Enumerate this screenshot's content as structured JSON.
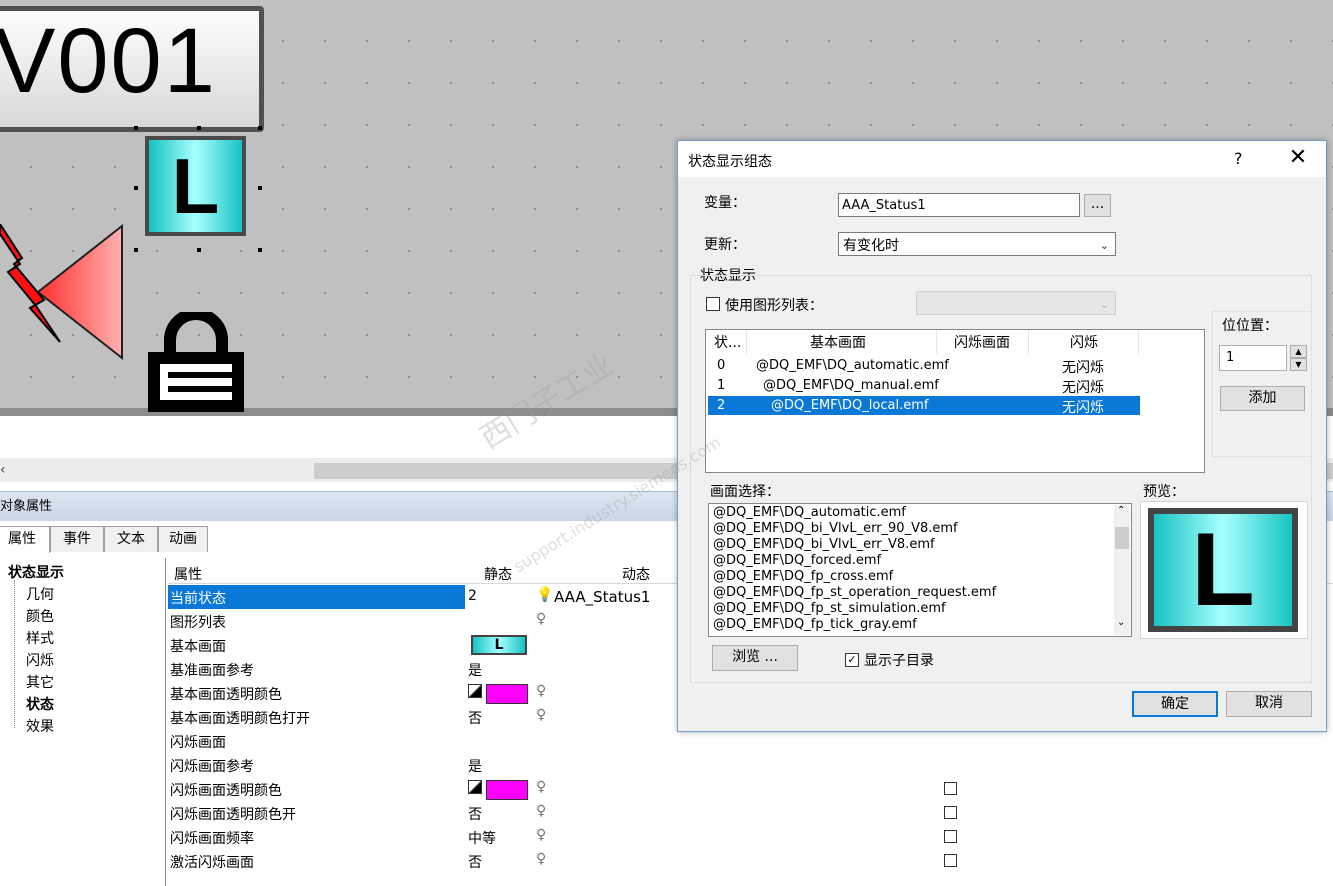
{
  "canvas": {
    "io_text": "V001",
    "l_icon_text": "L"
  },
  "properties_panel": {
    "title": "对象属性",
    "tabs": [
      "属性",
      "事件",
      "文本",
      "动画"
    ],
    "tree": {
      "root": "状态显示",
      "items": [
        "几何",
        "颜色",
        "样式",
        "闪烁",
        "其它",
        "状态",
        "效果"
      ]
    },
    "grid_headers": {
      "property": "属性",
      "static": "静态",
      "dynamic": "动态"
    },
    "rows": [
      {
        "name": "当前状态",
        "static": "2",
        "dynamic": "AAA_Status1"
      },
      {
        "name": "图形列表",
        "static": "",
        "dynamic": ""
      },
      {
        "name": "基本画面",
        "static": "L",
        "dynamic": ""
      },
      {
        "name": "基准画面参考",
        "static": "是",
        "dynamic": ""
      },
      {
        "name": "基本画面透明颜色",
        "static": "",
        "dynamic": ""
      },
      {
        "name": "基本画面透明颜色打开",
        "static": "否",
        "dynamic": ""
      },
      {
        "name": "闪烁画面",
        "static": "",
        "dynamic": ""
      },
      {
        "name": "闪烁画面参考",
        "static": "是",
        "dynamic": ""
      },
      {
        "name": "闪烁画面透明颜色",
        "static": "",
        "dynamic": ""
      },
      {
        "name": "闪烁画面透明颜色开",
        "static": "否",
        "dynamic": ""
      },
      {
        "name": "闪烁画面频率",
        "static": "中等",
        "dynamic": ""
      },
      {
        "name": "激活闪烁画面",
        "static": "否",
        "dynamic": ""
      }
    ]
  },
  "dialog": {
    "title": "状态显示组态",
    "help": "?",
    "close": "✕",
    "variable_label": "变量：",
    "variable_value": "AAA_Status1",
    "browse_var": "...",
    "update_label": "更新：",
    "update_value": "有变化时",
    "group_label": "状态显示",
    "use_graphic_list": "使用图形列表：",
    "bit_position_label": "位位置：",
    "bit_position_value": "1",
    "add_button": "添加",
    "state_headers": [
      "状...",
      "基本画面",
      "闪烁画面",
      "闪烁"
    ],
    "states": [
      {
        "state": "0",
        "basic": "@DQ_EMF\\DQ_automatic.emf",
        "flash": "",
        "blink": "无闪烁"
      },
      {
        "state": "1",
        "basic": "@DQ_EMF\\DQ_manual.emf",
        "flash": "",
        "blink": "无闪烁"
      },
      {
        "state": "2",
        "basic": "@DQ_EMF\\DQ_local.emf",
        "flash": "",
        "blink": "无闪烁"
      }
    ],
    "picture_select_label": "画面选择：",
    "pictures": [
      "@DQ_EMF\\DQ_automatic.emf",
      "@DQ_EMF\\DQ_bi_VlvL_err_90_V8.emf",
      "@DQ_EMF\\DQ_bi_VlvL_err_V8.emf",
      "@DQ_EMF\\DQ_forced.emf",
      "@DQ_EMF\\DQ_fp_cross.emf",
      "@DQ_EMF\\DQ_fp_st_operation_request.emf",
      "@DQ_EMF\\DQ_fp_st_simulation.emf",
      "@DQ_EMF\\DQ_fp_tick_gray.emf"
    ],
    "preview_label": "预览：",
    "preview_text": "L",
    "browse_button": "浏览 ...",
    "show_subdirs": "显示子目录",
    "ok": "确定",
    "cancel": "取消"
  },
  "watermark": "西门子工业",
  "watermark_url": "support.industry.siemens.com"
}
